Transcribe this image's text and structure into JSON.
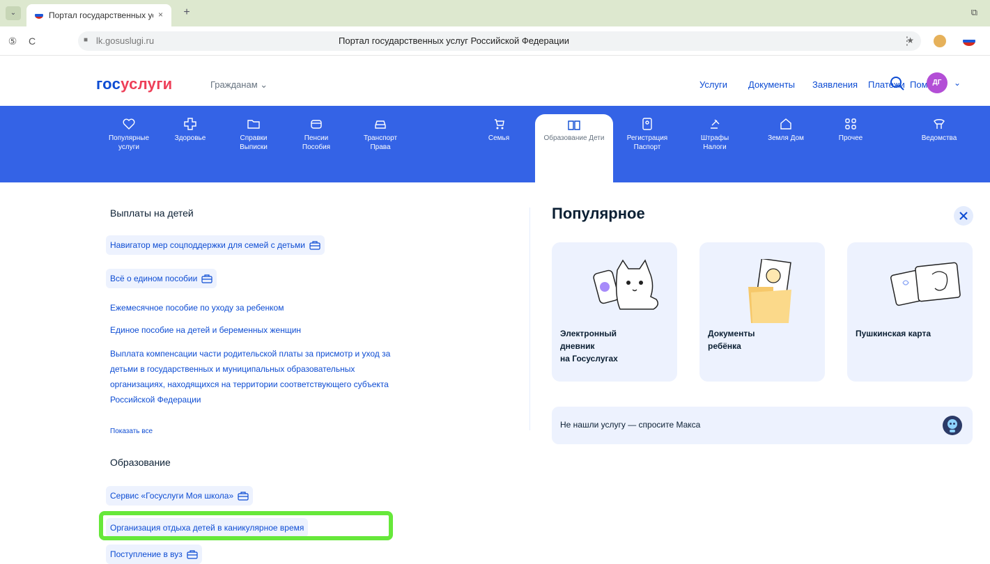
{
  "browser": {
    "tab_title": "Портал государственных услуг Российской Федерации",
    "tab_close": "×",
    "new_tab": "+",
    "url": "lk.gosuslugi.ru",
    "page_title": "Портал государственных услуг Российской Федерации",
    "bookmark": "★",
    "more": "⋮",
    "back": "⑤",
    "reload": "C"
  },
  "header": {
    "logo_part1": "гос",
    "logo_part2": "услуги",
    "audience": "Гражданам ⌄",
    "nav": [
      "Услуги",
      "Документы",
      "Заявления",
      "Платежи",
      "Помощь"
    ],
    "user_initials": "ДГ",
    "user_chevron": "⌄"
  },
  "categories": [
    {
      "label": "Популярные услуги",
      "icon": "heart-icon"
    },
    {
      "label": "Здоровье",
      "icon": "medical-cross-icon"
    },
    {
      "label": "Справки Выписки",
      "icon": "folder-icon"
    },
    {
      "label": "Пенсии Пособия",
      "icon": "wallet-icon"
    },
    {
      "label": "Транспорт Права",
      "icon": "car-icon"
    },
    {
      "label": "Семья",
      "icon": "stroller-icon"
    },
    {
      "label": "Образование Дети",
      "icon": "book-icon"
    },
    {
      "label": "Регистрация Паспорт",
      "icon": "id-card-icon"
    },
    {
      "label": "Штрафы Налоги",
      "icon": "gavel-icon"
    },
    {
      "label": "Земля Дом",
      "icon": "house-icon"
    },
    {
      "label": "Прочее",
      "icon": "grid-icon"
    },
    {
      "label": "Ведомства",
      "icon": "emblem-icon"
    }
  ],
  "payments_section": {
    "title": "Выплаты на детей",
    "links": [
      "Навигатор мер соцподдержки для семей с детьми",
      "Всё о едином пособии",
      "Ежемесячное пособие по уходу за ребенком",
      "Единое пособие на детей и беременных женщин",
      "Выплата компенсации части родительской платы за присмотр и уход за",
      "детьми в государственных и муниципальных образовательных",
      "организациях, находящихся на территории соответствующего субъекта",
      "Российской Федерации"
    ],
    "show_all": "Показать все"
  },
  "education_section": {
    "title": "Образование",
    "links": [
      "Сервис «Госуслуги Моя школа»",
      "Организация отдыха детей в каникулярное время",
      "Поступление в вуз"
    ]
  },
  "popular": {
    "title": "Популярное",
    "close": "✕",
    "cards": [
      {
        "line1": "Электронный",
        "line2": "дневник",
        "line3": "на Госуслугах"
      },
      {
        "line1": "Документы",
        "line2": "ребёнка",
        "line3": ""
      },
      {
        "line1": "Пушкинская карта",
        "line2": "",
        "line3": ""
      }
    ],
    "ask_text": "Не нашли услугу — спросите Макса"
  },
  "colors": {
    "brand_blue": "#0d4cd3",
    "category_bar": "#3463e6",
    "logo_red": "#ee3f58",
    "highlight_green": "#66e83a",
    "card_bg": "#edf2fe"
  }
}
